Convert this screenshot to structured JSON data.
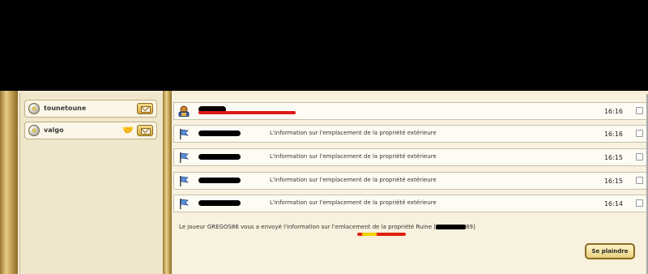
{
  "contacts": [
    {
      "name": "tounetoune"
    },
    {
      "name": "valgo"
    }
  ],
  "messages": [
    {
      "subject": "",
      "time": "16:16"
    },
    {
      "subject": "L'information sur l'emplacement de la propriété extérieure",
      "time": "16:16"
    },
    {
      "subject": "L'information sur l'emplacement de la propriété extérieure",
      "time": "16:15"
    },
    {
      "subject": "L'information sur l'emplacement de la propriété extérieure",
      "time": "16:15"
    },
    {
      "subject": "L'information sur l'emplacement de la propriété extérieure",
      "time": "16:14"
    }
  ],
  "message_body": {
    "text_start": "Le joueur GREGOS86 vous a envoyé l'information sur l'emlacement de la propriété Ruine [",
    "text_end": "89]"
  },
  "complain_button": "Se plaindre",
  "colors": {
    "accent_gold": "#d6a83c",
    "panel_bg": "#f6edd7"
  }
}
